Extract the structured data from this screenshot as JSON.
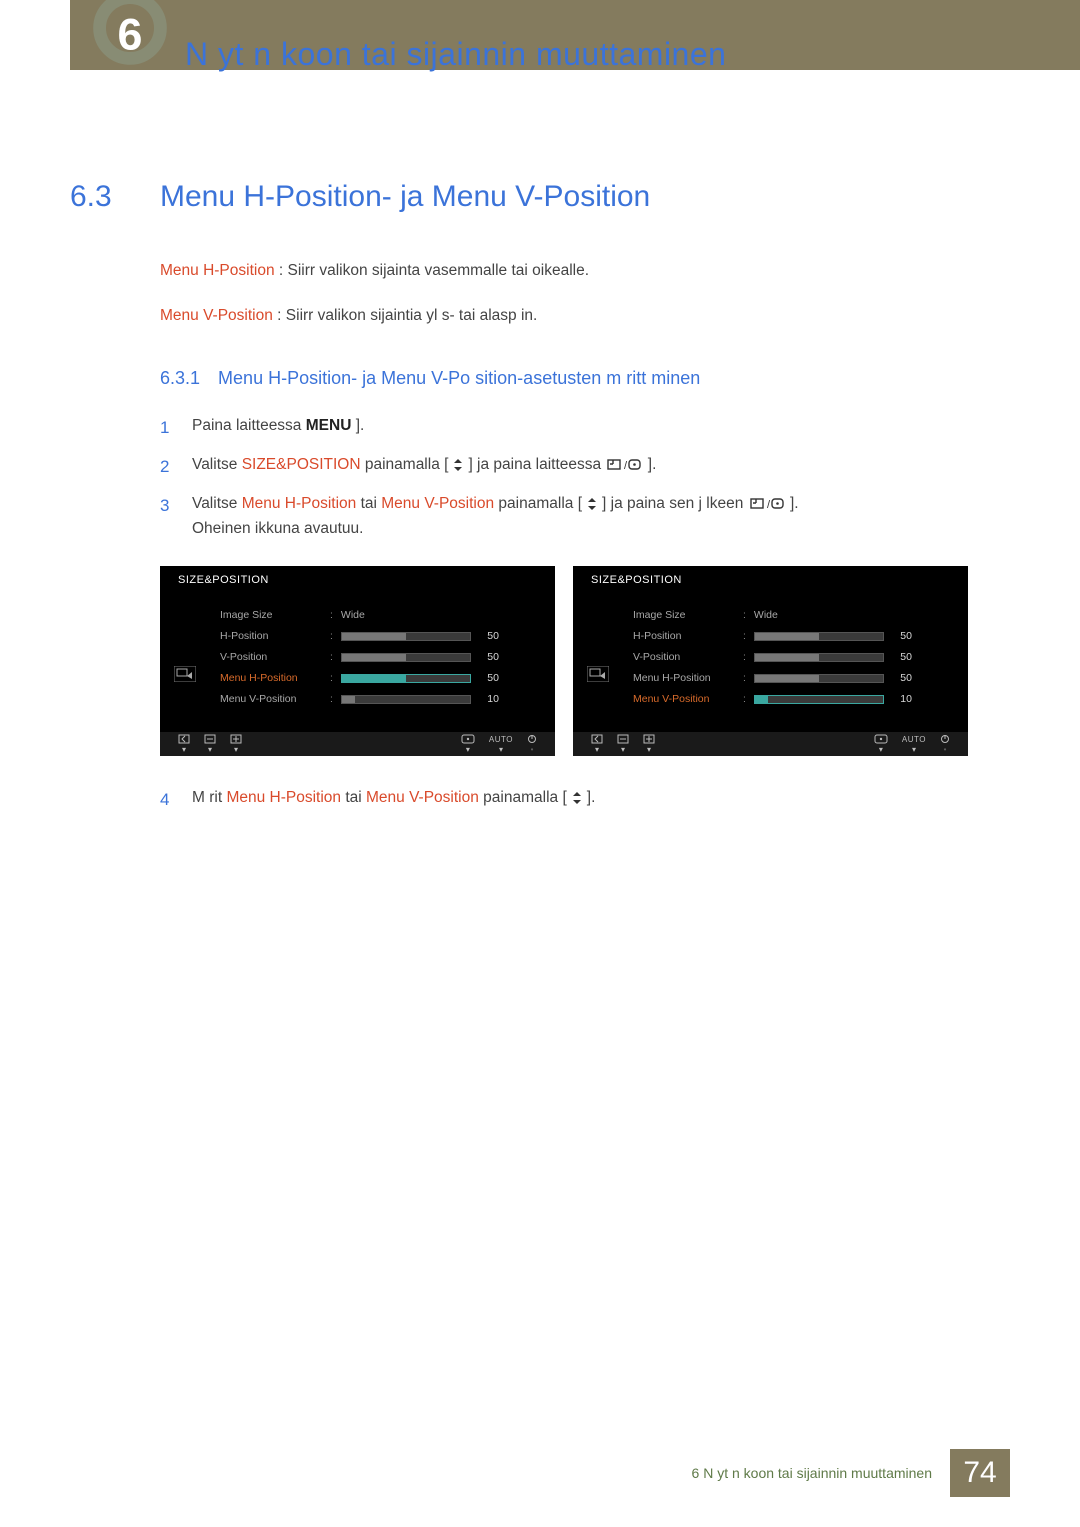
{
  "chapter": {
    "title": "N yt n koon tai sijainnin muuttaminen"
  },
  "section": {
    "num": "6.3",
    "title": "Menu H-Position- ja Menu V-Position"
  },
  "desc": {
    "hpos_label": "Menu H-Position",
    "hpos_text": " : Siirr  valikon sijainta vasemmalle tai oikealle.",
    "vpos_label": "Menu V-Position",
    "vpos_text": " : Siirr  valikon sijaintia yl s- tai alasp in."
  },
  "subsec": {
    "num": "6.3.1",
    "title": "Menu H-Position- ja Menu V-Po   sition-asetusten   m   ritt minen"
  },
  "steps": {
    "s1": {
      "num": "1",
      "t1": "Paina laitteessa ",
      "menu": "MENU",
      "t2": " ]."
    },
    "s2": {
      "num": "2",
      "t1": "Valitse ",
      "sp": "SIZE&POSITION",
      "t2": " painamalla [",
      "t3": "] ja paina laitteessa ",
      "t4": " ]."
    },
    "s3": {
      "num": "3",
      "t1": "Valitse ",
      "hp": "Menu H-Position",
      "t2": " tai ",
      "vp": "Menu V-Position",
      "t3": "  painamalla [",
      "t4": "] ja paina sen j lkeen ",
      "t5": " ].",
      "t6": "Oheinen ikkuna avautuu."
    },
    "s4": {
      "num": "4",
      "t1": "M  rit   ",
      "hp": "Menu H-Position",
      "t2": " tai ",
      "vp": "Menu V-Position",
      "t3": " painamalla [",
      "t4": "]."
    }
  },
  "osd_common": {
    "title": "SIZE&POSITION",
    "image_size": "Image Size",
    "wide": "Wide",
    "hpos": "H-Position",
    "vpos": "V-Position",
    "mhpos": "Menu H-Position",
    "mvpos": "Menu V-Position",
    "v50": "50",
    "v10": "10",
    "auto": "AUTO"
  },
  "chart_data": [
    {
      "type": "table",
      "title": "SIZE&POSITION (Menu H-Position selected)",
      "rows": [
        {
          "label": "Image Size",
          "value": "Wide"
        },
        {
          "label": "H-Position",
          "value": 50
        },
        {
          "label": "V-Position",
          "value": 50
        },
        {
          "label": "Menu H-Position",
          "value": 50,
          "selected": true
        },
        {
          "label": "Menu V-Position",
          "value": 10
        }
      ]
    },
    {
      "type": "table",
      "title": "SIZE&POSITION (Menu V-Position selected)",
      "rows": [
        {
          "label": "Image Size",
          "value": "Wide"
        },
        {
          "label": "H-Position",
          "value": 50
        },
        {
          "label": "V-Position",
          "value": 50
        },
        {
          "label": "Menu H-Position",
          "value": 50
        },
        {
          "label": "Menu V-Position",
          "value": 10,
          "selected": true
        }
      ]
    }
  ],
  "footer": {
    "text": "6 N yt n koon tai sijainnin muuttaminen",
    "page": "74"
  }
}
